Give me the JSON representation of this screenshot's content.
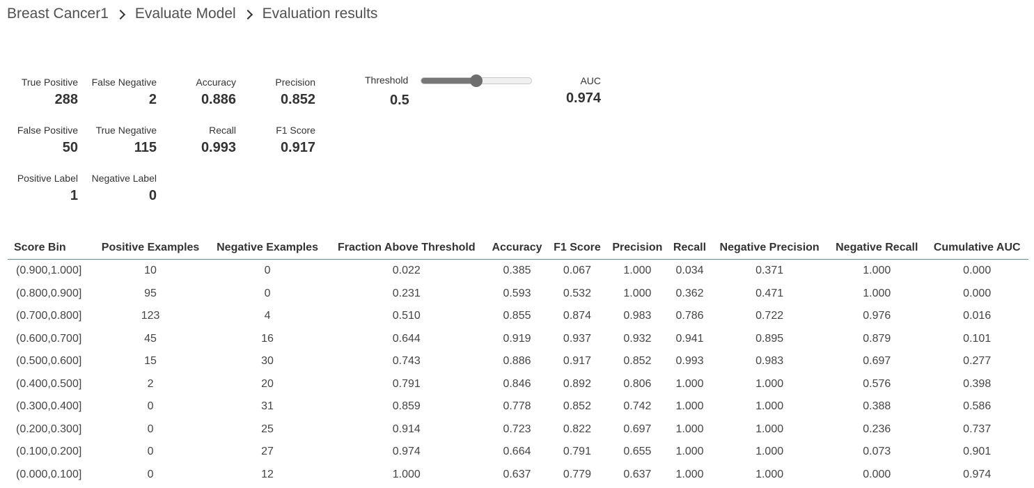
{
  "breadcrumb": {
    "items": [
      "Breast Cancer1",
      "Evaluate Model",
      "Evaluation results"
    ]
  },
  "metrics": {
    "true_positive": {
      "label": "True Positive",
      "value": "288"
    },
    "false_negative": {
      "label": "False Negative",
      "value": "2"
    },
    "accuracy": {
      "label": "Accuracy",
      "value": "0.886"
    },
    "precision": {
      "label": "Precision",
      "value": "0.852"
    },
    "false_positive": {
      "label": "False Positive",
      "value": "50"
    },
    "true_negative": {
      "label": "True Negative",
      "value": "115"
    },
    "recall": {
      "label": "Recall",
      "value": "0.993"
    },
    "f1_score": {
      "label": "F1 Score",
      "value": "0.917"
    },
    "positive_label": {
      "label": "Positive Label",
      "value": "1"
    },
    "negative_label": {
      "label": "Negative Label",
      "value": "0"
    },
    "auc": {
      "label": "AUC",
      "value": "0.974"
    }
  },
  "threshold": {
    "label": "Threshold",
    "value": "0.5",
    "slider_fraction": 0.5
  },
  "table": {
    "headers": [
      "Score Bin",
      "Positive Examples",
      "Negative Examples",
      "Fraction Above Threshold",
      "Accuracy",
      "F1 Score",
      "Precision",
      "Recall",
      "Negative Precision",
      "Negative Recall",
      "Cumulative AUC"
    ],
    "rows": [
      [
        "(0.900,1.000]",
        "10",
        "0",
        "0.022",
        "0.385",
        "0.067",
        "1.000",
        "0.034",
        "0.371",
        "1.000",
        "0.000"
      ],
      [
        "(0.800,0.900]",
        "95",
        "0",
        "0.231",
        "0.593",
        "0.532",
        "1.000",
        "0.362",
        "0.471",
        "1.000",
        "0.000"
      ],
      [
        "(0.700,0.800]",
        "123",
        "4",
        "0.510",
        "0.855",
        "0.874",
        "0.983",
        "0.786",
        "0.722",
        "0.976",
        "0.016"
      ],
      [
        "(0.600,0.700]",
        "45",
        "16",
        "0.644",
        "0.919",
        "0.937",
        "0.932",
        "0.941",
        "0.895",
        "0.879",
        "0.101"
      ],
      [
        "(0.500,0.600]",
        "15",
        "30",
        "0.743",
        "0.886",
        "0.917",
        "0.852",
        "0.993",
        "0.983",
        "0.697",
        "0.277"
      ],
      [
        "(0.400,0.500]",
        "2",
        "20",
        "0.791",
        "0.846",
        "0.892",
        "0.806",
        "1.000",
        "1.000",
        "0.576",
        "0.398"
      ],
      [
        "(0.300,0.400]",
        "0",
        "31",
        "0.859",
        "0.778",
        "0.852",
        "0.742",
        "1.000",
        "1.000",
        "0.388",
        "0.586"
      ],
      [
        "(0.200,0.300]",
        "0",
        "25",
        "0.914",
        "0.723",
        "0.822",
        "0.697",
        "1.000",
        "1.000",
        "0.236",
        "0.737"
      ],
      [
        "(0.100,0.200]",
        "0",
        "27",
        "0.974",
        "0.664",
        "0.791",
        "0.655",
        "1.000",
        "1.000",
        "0.073",
        "0.901"
      ],
      [
        "(0.000,0.100]",
        "0",
        "12",
        "1.000",
        "0.637",
        "0.779",
        "0.637",
        "1.000",
        "1.000",
        "0.000",
        "0.974"
      ]
    ]
  }
}
